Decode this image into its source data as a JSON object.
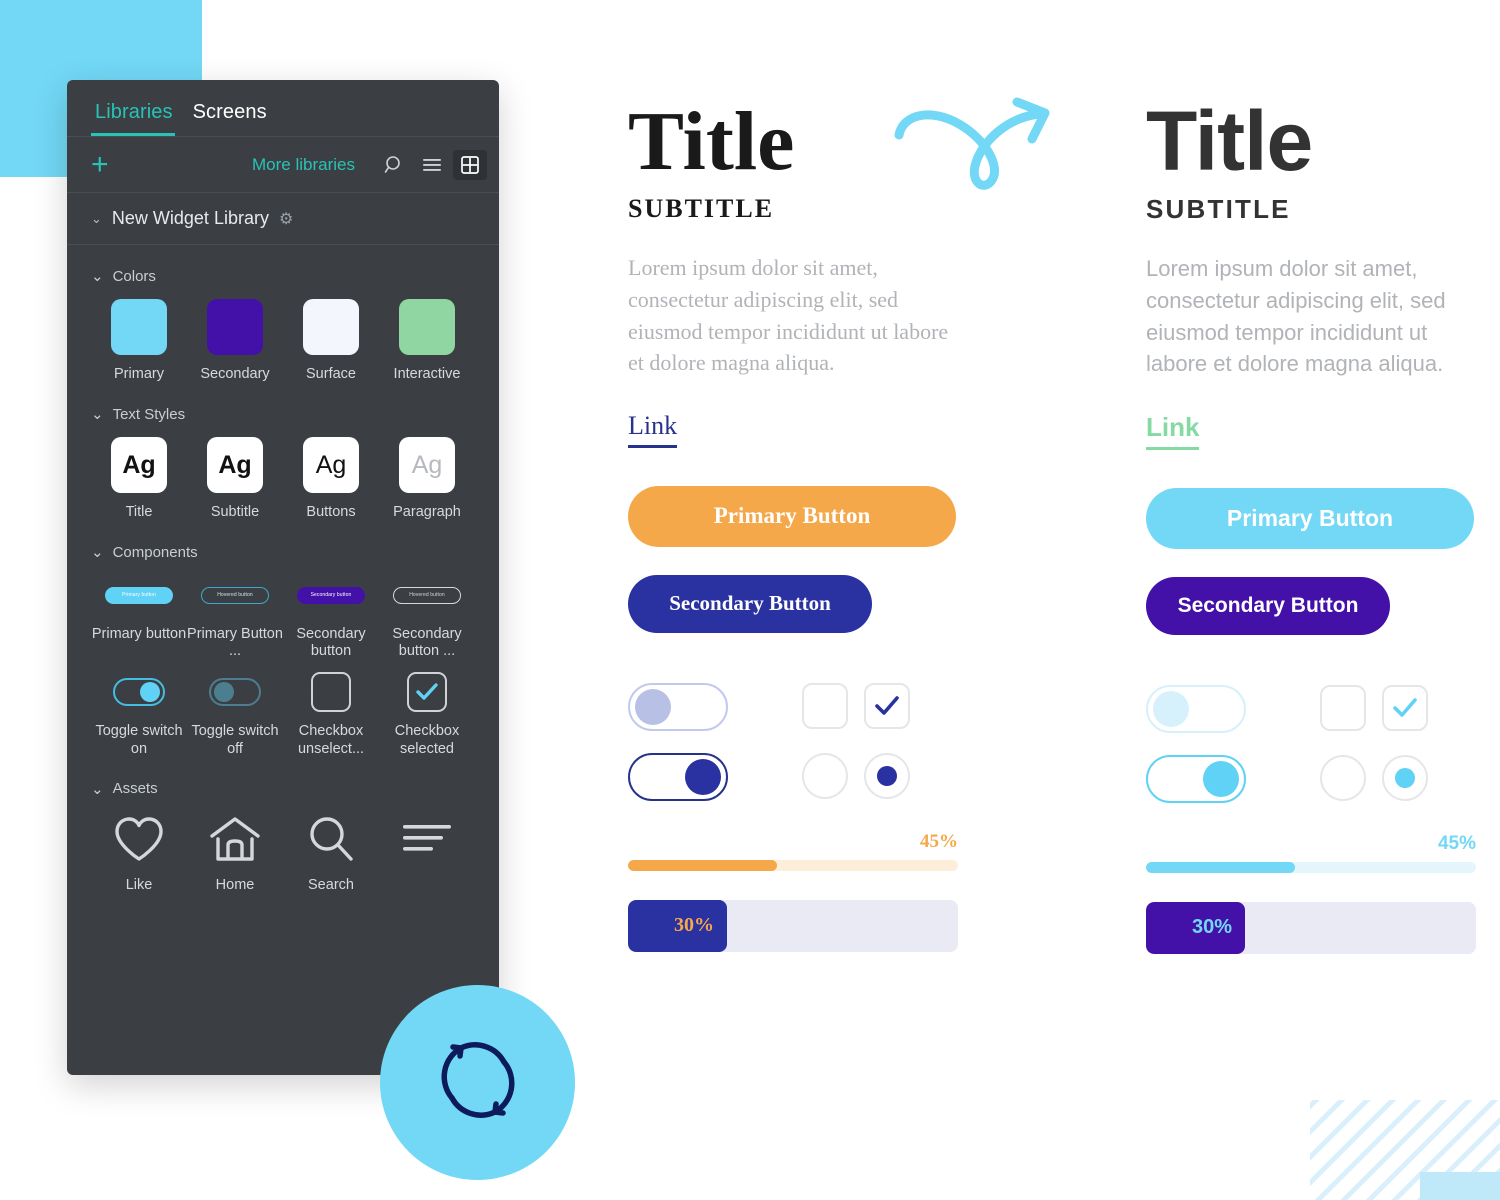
{
  "panel": {
    "tabs": [
      {
        "label": "Libraries",
        "active": true
      },
      {
        "label": "Screens",
        "active": false
      }
    ],
    "toolbar": {
      "add_label": "+",
      "more_libraries_label": "More libraries",
      "search_icon": "search-icon",
      "list_view_icon": "list-view-icon",
      "grid_view_icon": "grid-view-icon"
    },
    "library": {
      "name": "New Widget Library",
      "chevron": "⌄",
      "settings_icon": "gear-icon"
    },
    "sections": [
      {
        "title": "Colors",
        "chevron": "⌄",
        "items": [
          {
            "label": "Primary",
            "color": "#72d8f5"
          },
          {
            "label": "Secondary",
            "color": "#4311a8"
          },
          {
            "label": "Surface",
            "color": "#f4f6fd"
          },
          {
            "label": "Interactive",
            "color": "#8fd6a3"
          }
        ]
      },
      {
        "title": "Text Styles",
        "chevron": "⌄",
        "items": [
          {
            "label": "Title",
            "glyph": "Ag",
            "style": "bold"
          },
          {
            "label": "Subtitle",
            "glyph": "Ag",
            "style": "bold"
          },
          {
            "label": "Buttons",
            "glyph": "Ag",
            "style": "regular"
          },
          {
            "label": "Paragraph",
            "glyph": "Ag",
            "style": "muted"
          }
        ]
      },
      {
        "title": "Components",
        "chevron": "⌄",
        "items": [
          {
            "label": "Primary button",
            "thumb": "mini-button-filled-cyan",
            "mini_text": "Primary button"
          },
          {
            "label": "Primary Button ...",
            "thumb": "mini-button-outline-cyan",
            "mini_text": "Hovered button"
          },
          {
            "label": "Secondary button",
            "thumb": "mini-button-filled-purple",
            "mini_text": "Secondary button"
          },
          {
            "label": "Secondary button ...",
            "thumb": "mini-button-outline-white",
            "mini_text": "Hovered button"
          },
          {
            "label": "Toggle switch on",
            "thumb": "toggle-on"
          },
          {
            "label": "Toggle switch off",
            "thumb": "toggle-off"
          },
          {
            "label": "Checkbox unselect...",
            "thumb": "checkbox-unselected"
          },
          {
            "label": "Checkbox selected",
            "thumb": "checkbox-selected"
          }
        ]
      },
      {
        "title": "Assets",
        "chevron": "⌄",
        "items": [
          {
            "label": "Like",
            "icon": "heart-icon"
          },
          {
            "label": "Home",
            "icon": "home-icon"
          },
          {
            "label": "Search",
            "icon": "search-icon"
          },
          {
            "label": "",
            "icon": "menu-lines-icon"
          }
        ]
      }
    ]
  },
  "badge": {
    "icon": "refresh-sync-icon",
    "background": "#72d8f5",
    "stroke": "#0d1a5c"
  },
  "arrow": {
    "icon": "curly-arrow-icon",
    "color": "#72d8f5"
  },
  "preview_left": {
    "title": "Title",
    "subtitle": "SUBTITLE",
    "paragraph": "Lorem ipsum dolor sit amet, consectetur adipiscing elit, sed eiusmod tempor incididunt ut labore et dolore magna aliqua.",
    "link": "Link",
    "link_color": "#26338c",
    "primary_button": "Primary Button",
    "primary_color": "#f5a849",
    "secondary_button": "Secondary Button",
    "secondary_color": "#2a31a0",
    "toggle_off_track": "#c3c9ee",
    "toggle_off_knob": "#b9c0e6",
    "toggle_on_track": "#26338c",
    "toggle_on_knob": "#2a31a0",
    "control_accent": "#2a31a0",
    "progress_thin": {
      "value": "45%",
      "percent": 45,
      "fill": "#f5a849",
      "track": "#fdeed9"
    },
    "progress_thick": {
      "value": "30%",
      "percent": 30,
      "fill": "#2a31a0",
      "track": "#e9eaf3"
    }
  },
  "preview_right": {
    "title": "Title",
    "subtitle": "SUBTITLE",
    "paragraph": "Lorem ipsum dolor sit amet, consectetur adipiscing elit, sed eiusmod tempor incididunt ut labore et dolore magna aliqua.",
    "link": "Link",
    "link_color": "#85d9a2",
    "primary_button": "Primary Button",
    "primary_color": "#72d8f5",
    "secondary_button": "Secondary Button",
    "secondary_color": "#4311a8",
    "toggle_off_track": "#d6f1fb",
    "toggle_off_knob": "#d6f1fb",
    "toggle_on_track": "#5fd2f5",
    "toggle_on_knob": "#5fd2f5",
    "control_accent": "#5fd2f5",
    "progress_thin": {
      "value": "45%",
      "percent": 45,
      "fill": "#72d8f5",
      "track": "#e4f6fc"
    },
    "progress_thick": {
      "value": "30%",
      "percent": 30,
      "fill": "#4311a8",
      "track": "#e9eaf3"
    }
  }
}
